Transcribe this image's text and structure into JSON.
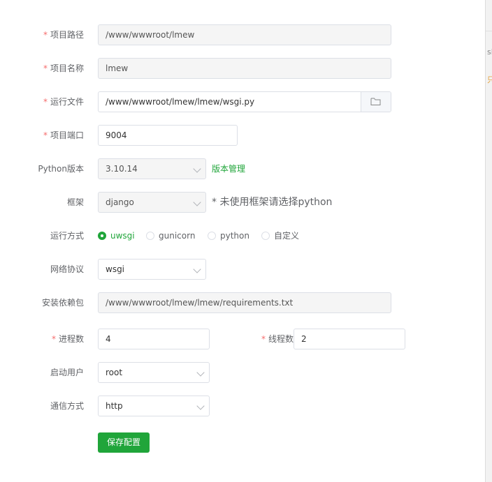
{
  "form": {
    "project_path": {
      "label": "项目路径",
      "value": "/www/wwwroot/lmew"
    },
    "project_name": {
      "label": "项目名称",
      "value": "lmew"
    },
    "run_file": {
      "label": "运行文件",
      "value": "/www/wwwroot/lmew/lmew/wsgi.py"
    },
    "project_port": {
      "label": "项目端口",
      "value": "9004"
    },
    "python_version": {
      "label": "Python版本",
      "value": "3.10.14",
      "link": "版本管理"
    },
    "framework": {
      "label": "框架",
      "value": "django",
      "hint": "* 未使用框架请选择python"
    },
    "run_mode": {
      "label": "运行方式",
      "options": [
        "uwsgi",
        "gunicorn",
        "python",
        "自定义"
      ],
      "selected": "uwsgi"
    },
    "network_protocol": {
      "label": "网络协议",
      "value": "wsgi"
    },
    "install_deps": {
      "label": "安装依赖包",
      "value": "/www/wwwroot/lmew/lmew/requirements.txt"
    },
    "processes": {
      "label": "进程数",
      "value": "4"
    },
    "threads": {
      "label": "线程数",
      "value": "2"
    },
    "start_user": {
      "label": "启动用户",
      "value": "root"
    },
    "comm_mode": {
      "label": "通信方式",
      "value": "http"
    },
    "save_label": "保存配置"
  },
  "right_panel": {
    "fragment_1": "sl",
    "fragment_2": "只"
  },
  "colors": {
    "accent": "#20a53a",
    "required": "#f56c6c",
    "border": "#dcdfe6"
  },
  "required_mark": "*",
  "icons": {
    "folder": "folder-icon",
    "select": "chevron-down-icon"
  }
}
